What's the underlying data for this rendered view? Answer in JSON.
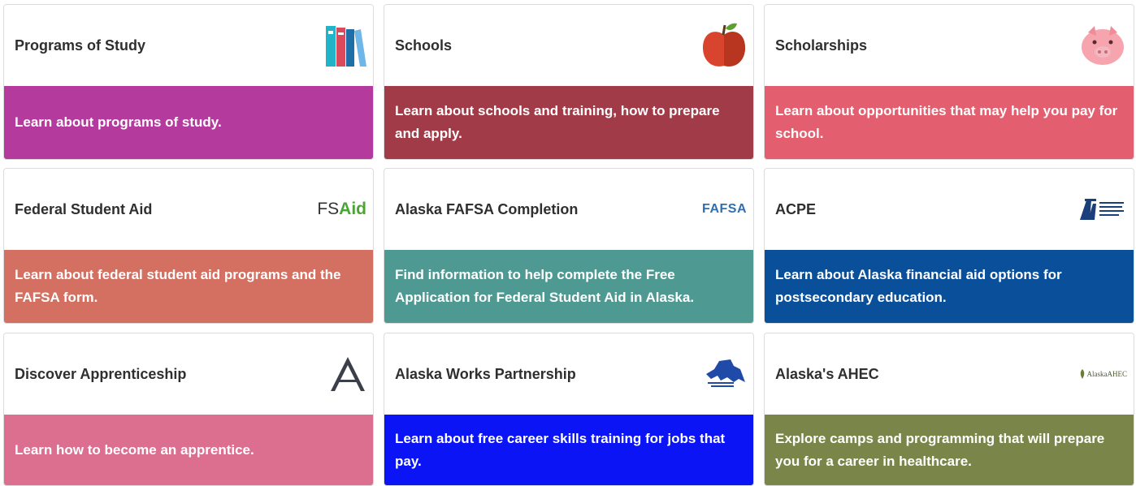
{
  "cards": [
    {
      "title": "Programs of Study",
      "description": "Learn about programs of study.",
      "color": "#b53a9e",
      "icon": "books-icon"
    },
    {
      "title": "Schools",
      "description": "Learn about schools and training, how to prepare and apply.",
      "color": "#a23b48",
      "icon": "apple-icon"
    },
    {
      "title": "Scholarships",
      "description": "Learn about opportunities that may help you pay for school.",
      "color": "#e35e6e",
      "icon": "piggy-bank-icon"
    },
    {
      "title": "Federal Student Aid",
      "description": "Learn about federal student aid programs and the FAFSA form.",
      "color": "#d47062",
      "icon": "fsaid-logo",
      "logo_text_a": "FS",
      "logo_text_b": "Aid"
    },
    {
      "title": "Alaska FAFSA Completion",
      "description": "Find information to help complete the Free Application for Federal Student Aid in Alaska.",
      "color": "#4f9993",
      "icon": "fafsa-logo",
      "logo_text": "FAFSA"
    },
    {
      "title": "ACPE",
      "description": "Learn about Alaska financial aid options for postsecondary education.",
      "color": "#0a4f99",
      "icon": "acpe-logo"
    },
    {
      "title": "Discover Apprenticeship",
      "description": "Learn how to become an apprentice.",
      "color": "#dc6e8f",
      "icon": "apprenticeship-a-logo"
    },
    {
      "title": "Alaska Works Partnership",
      "description": "Learn about free career skills training for jobs that pay.",
      "color": "#0a14f5",
      "icon": "alaska-works-logo"
    },
    {
      "title": "Alaska's AHEC",
      "description": "Explore camps and programming that will prepare you for a career in healthcare.",
      "color": "#7a8649",
      "icon": "alaska-ahec-logo",
      "logo_text": "AlaskaAHEC"
    }
  ]
}
